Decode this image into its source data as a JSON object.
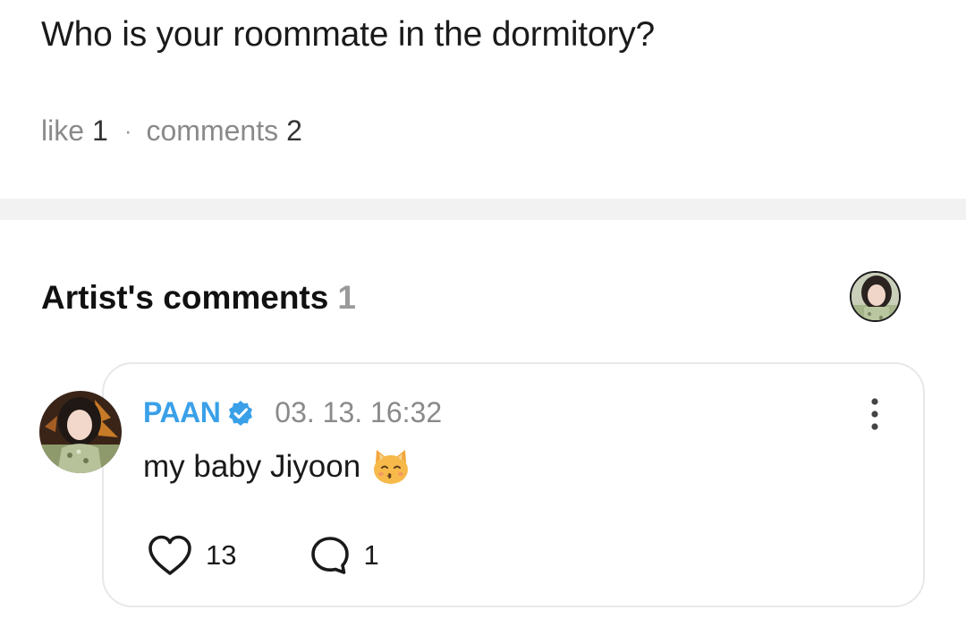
{
  "post": {
    "title": "Who is your roommate in the dormitory?",
    "like_label": "like",
    "like_count": "1",
    "separator": "·",
    "comments_label": "comments",
    "comments_count": "2"
  },
  "artist_comments": {
    "title": "Artist's comments",
    "count": "1",
    "filter_avatar_icon": "artist-avatar"
  },
  "comment": {
    "author": "PAAN",
    "verified_icon": "verified-check-icon",
    "timestamp": "03. 13. 16:32",
    "text": "my baby Jiyoon",
    "emoji": "kissing-cat-face",
    "likes": "13",
    "replies": "1"
  },
  "colors": {
    "author": "#3aa0e8",
    "divider": "#f2f2f3",
    "muted": "#8a8a8a",
    "card_border": "#e8e8ec"
  }
}
